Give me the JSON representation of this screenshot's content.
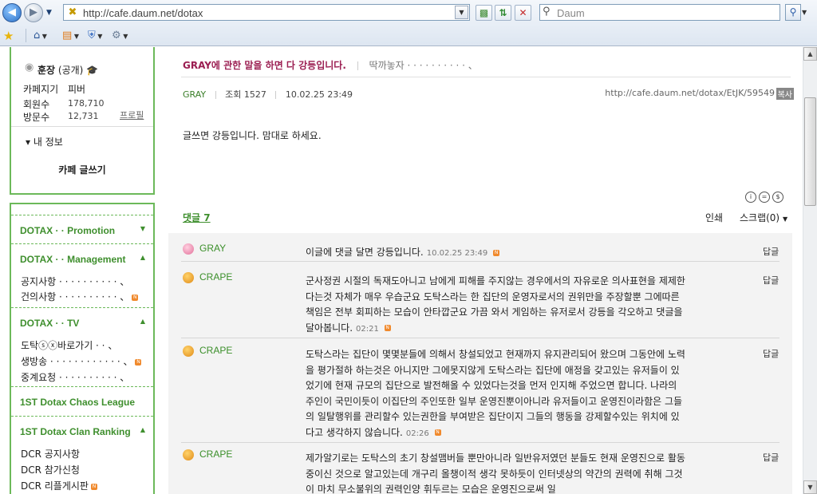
{
  "browser": {
    "url": "http://cafe.daum.net/dotax",
    "search_placeholder": "Daum",
    "icons": {
      "back": "back-arrow-icon",
      "forward": "forward-arrow-icon",
      "site": "daum-favicon",
      "compat": "compatibility-icon",
      "refresh": "refresh-icon",
      "stop": "stop-icon",
      "search": "magnifier-icon",
      "favorites": "star-icon",
      "home": "home-icon",
      "feeds": "page-icon",
      "safety": "shield-icon",
      "tools": "gear-icon"
    }
  },
  "sidebar": {
    "owner_label": "훈장",
    "owner_visibility": "(공개)",
    "rows": [
      {
        "label": "카페지기",
        "value": "피버"
      },
      {
        "label": "회원수",
        "value": "178,710"
      },
      {
        "label": "방문수",
        "value": "12,731"
      }
    ],
    "profile_link": "프로필",
    "my_info": "▾ 내 정보",
    "write_button": "카페 글쓰기",
    "menu": [
      {
        "title": "DOTAX · · Promotion",
        "arrow": "▼",
        "items": []
      },
      {
        "title": "DOTAX · · Management",
        "arrow": "▲",
        "items": [
          {
            "label": "공지사항 · · · · · · · · · · 、",
            "new": false
          },
          {
            "label": "건의사항 · · · · · · · · · · 、",
            "new": true
          }
        ]
      },
      {
        "title": "DOTAX · · TV",
        "arrow": "▲",
        "items": [
          {
            "label": "도탁ⓢⓧ바로가기 · · 、",
            "new": false
          },
          {
            "label": "생방송 · · · · · · · · · · · · 、",
            "new": true
          },
          {
            "label": "중계요청 · · · · · · · · · · 、",
            "new": false
          }
        ]
      },
      {
        "title": "1ST Dotax Chaos League",
        "arrow": "",
        "items": []
      },
      {
        "title": "1ST Dotax Clan Ranking",
        "arrow": "▲",
        "items": [
          {
            "label": "DCR 공지사항",
            "new": false
          },
          {
            "label": "DCR 참가신청",
            "new": false
          },
          {
            "label": "DCR 리플게시판",
            "new": true
          }
        ]
      }
    ],
    "colors": {
      "accent": "#6cb95a",
      "menu_title": "#3f8f2e"
    }
  },
  "post": {
    "title": "GRAY에 관한 말을 하면 다 강등입니다.",
    "title_nick": "딱까놓자 · · · · · · · · · · 、",
    "author": "GRAY",
    "views": "조회 1527",
    "date": "10.02.25 23:49",
    "url": "http://cafe.daum.net/dotax/EtJK/59549",
    "copy_label": "복사",
    "body": "글쓰면 강등입니다. 맘대로 하세요.",
    "title_color": "#9b1f52"
  },
  "comments_header": {
    "label": "댓글 7",
    "print": "인쇄",
    "scrap": "스크랩(0)"
  },
  "comments": [
    {
      "nick": "GRAY",
      "icon": "peach-icon",
      "text": "이글에 댓글 달면 강등입니다.",
      "time": "10.02.25 23:49",
      "reply": "답글"
    },
    {
      "nick": "CRAPE",
      "icon": "pineapple-icon",
      "text": "군사정권 시절의 독재도아니고 남에게 피해를 주지않는 경우에서의 자유로운 의사표현을 제제한다는것 자체가 매우 우습군요 도탁스라는 한 집단의 운영자로서의 권위만을 주장할뿐 그에따른 책임은 전부 회피하는 모습이 안타깝군요 가끔 와서 게임하는 유저로서 강등을 각오하고 댓글을 달아봅니다.",
      "time": "02:21",
      "reply": "답글"
    },
    {
      "nick": "CRAPE",
      "icon": "pineapple-icon",
      "text": "도탁스라는 집단이 몇몇분들에 의해서 창설되었고 현재까지 유지관리되어 왔으며 그동안에 노력을 평가절하 하는것은 아니지만 그에못지않게 도탁스라는 집단에 애정을 갖고있는 유저들이 있었기에 현재 규모의 집단으로 발전해올 수 있었다는것을 먼저 인지해 주었으면 합니다. 나라의 주인이 국민이듯이 이집단의 주인또한 일부 운영진뿐이아니라 유저들이고 운영진이라함은 그들의 일탈행위를 관리할수 있는권한을 부여받은 집단이지 그들의 행동을 강제할수있는 위치에 있다고 생각하지 않습니다.",
      "time": "02:26",
      "reply": "답글"
    },
    {
      "nick": "CRAPE",
      "icon": "pineapple-icon",
      "text": "제가알기로는 도탁스의 초기 창설맴버들 뿐만아니라 일반유저였던 분들도 현재 운영진으로 활동중이신 것으로 알고있는데 개구리 올챙이적 생각 못하듯이 인터넷상의 약간의 권력에 취해 그것이 마치 무소불위의 권력인양 휘두르는 모습은 운영진으로써 일",
      "time": "",
      "reply": "답글"
    }
  ]
}
